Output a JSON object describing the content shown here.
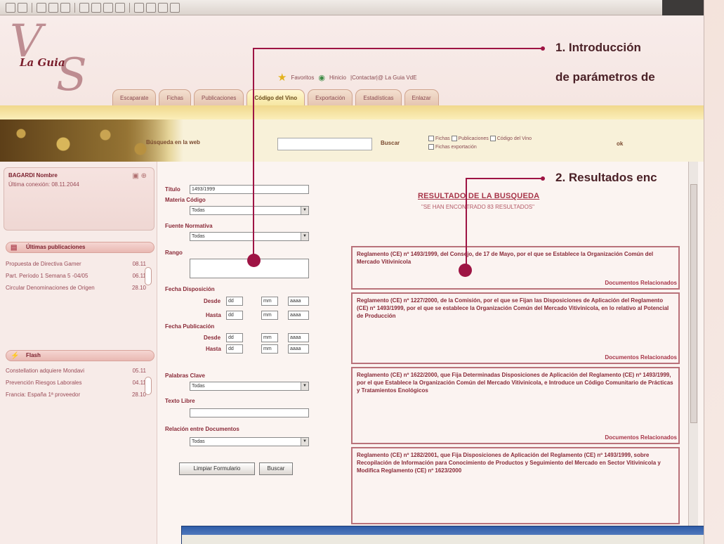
{
  "header": {
    "logo_text": "La Guia",
    "links": {
      "favoritos": "Favoritos",
      "inicio": "Hinicio",
      "contactar": "|Contactar|@ La Guia VdE"
    },
    "tabs": [
      {
        "label": "Escaparate"
      },
      {
        "label": "Fichas"
      },
      {
        "label": "Publicaciones"
      },
      {
        "label": "Código del Vino"
      },
      {
        "label": "Exportación"
      },
      {
        "label": "Estadísticas"
      },
      {
        "label": "Enlazar"
      }
    ]
  },
  "search": {
    "label": "Búsqueda en la web",
    "go": "Buscar",
    "checks": [
      "Fichas",
      "Publicaciones",
      "Código del Vino",
      "Fichas exportación"
    ],
    "ok": "ok"
  },
  "sidebar": {
    "user": {
      "name": "BAGARDI Nombre",
      "last_login": "Última conexión: 08.11.2044"
    },
    "latest": {
      "title": "Últimas publicaciones",
      "items": [
        {
          "text": "Propuesta de Directiva Gamer",
          "date": "08.11"
        },
        {
          "text": "Part. Período 1 Semana 5 -04/05",
          "date": "06.11"
        },
        {
          "text": "Circular Denominaciones de Origen",
          "date": "28.10"
        }
      ]
    },
    "flash": {
      "title": "Flash",
      "items": [
        {
          "text": "Constellation adquiere Mondavi",
          "date": "05.11"
        },
        {
          "text": "Prevención Riesgos Laborales",
          "date": "04.11"
        },
        {
          "text": "Francia: España 1ª proveedor",
          "date": "28.10"
        }
      ]
    }
  },
  "form": {
    "titulo_label": "Título",
    "titulo_value": "1493/1999",
    "materia_label": "Materia Código",
    "materia_value": "Todas",
    "fuente_label": "Fuente Normativa",
    "fuente_value": "Todas",
    "rango_label": "Rango",
    "fecha_disp_label": "Fecha Disposición",
    "fecha_pub_label": "Fecha Publicación",
    "desde": "Desde",
    "hasta": "Hasta",
    "dd": "dd",
    "mm": "mm",
    "aaaa": "aaaa",
    "palabras_label": "Palabras Clave",
    "palabras_value": "Todas",
    "texto_label": "Texto Libre",
    "relacion_label": "Relación entre Documentos",
    "relacion_value": "Todas",
    "limpiar": "Limpiar Formulario",
    "buscar": "Buscar"
  },
  "results": {
    "title": "RESULTADO DE LA BUSQUEDA",
    "count": "\"SE HAN ENCONTRADO 83 RESULTADOS\"",
    "related_label": "Documentos Relacionados",
    "items": [
      {
        "text": "Reglamento (CE) nº 1493/1999, del Consejo, de 17 de Mayo, por el que se Establece la Organización Común del Mercado Vitivinícola"
      },
      {
        "text": "Reglamento (CE) nº 1227/2000, de la Comisión, por el que se Fijan las Disposiciones de Aplicación del Reglamento (CE) nº 1493/1999, por el que se establece la Organización Común del Mercado Vitivinícola, en lo relativo al Potencial de Producción"
      },
      {
        "text": "Reglamento (CE) nº 1622/2000, que Fija Determinadas Disposiciones de Aplicación del Reglamento (CE) nº 1493/1999, por el que Establece la Organización Común del Mercado Vitivinícola, e Introduce un Código Comunitario de Prácticas y Tratamientos Enológicos"
      },
      {
        "text": "Reglamento (CE) nº 1282/2001, que Fija Disposiciones de Aplicación del Reglamento (CE) nº 1493/1999, sobre Recopilación de Información para Conocimiento de Productos y Seguimiento del Mercado en Sector Vitivinícola y Modifica Reglamento (CE) nº 1623/2000"
      }
    ]
  },
  "annotations": {
    "a1_line1": "1. Introducción",
    "a1_line2": "de parámetros de",
    "a2": "2. Resultados enc"
  }
}
